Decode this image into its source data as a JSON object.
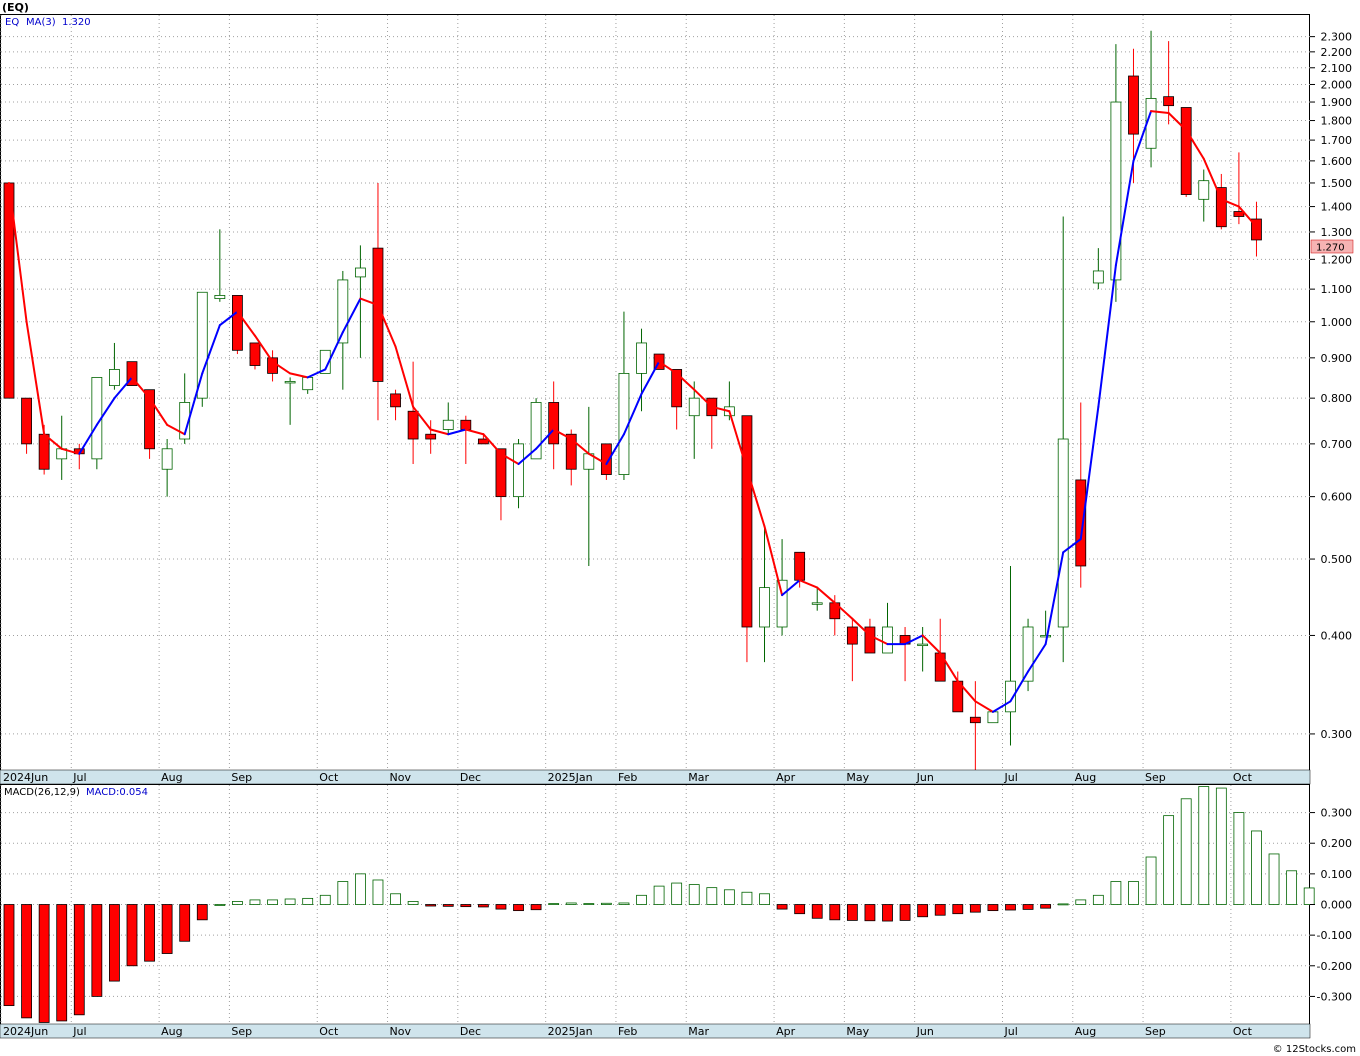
{
  "header": {
    "symbol": "(EQ)",
    "legend_symbol": "EQ",
    "legend_ma": "MA(3)",
    "legend_ma_value": "1.320",
    "last_price": "1.270",
    "macd_label": "MACD(26,12,9)",
    "macd_value": "MACD:0.054",
    "footer": "© 12Stocks.com"
  },
  "colors": {
    "up": "#006400",
    "down": "#ff0000",
    "ma_up": "#0000ff",
    "ma_down": "#ff0000",
    "grid": "#a0a0a0",
    "axis_band": "#cfe4ec",
    "price_tag": "#f6b3b3"
  },
  "chart_data": [
    {
      "type": "candlestick",
      "scale": "log",
      "ylim": [
        0.27,
        2.45
      ],
      "yticks": [
        "0.300",
        "0.400",
        "0.500",
        "0.600",
        "0.700",
        "0.800",
        "0.900",
        "1.000",
        "1.100",
        "1.200",
        "1.300",
        "1.400",
        "1.500",
        "1.600",
        "1.700",
        "1.800",
        "1.900",
        "2.000",
        "2.100",
        "2.200",
        "2.300"
      ],
      "month_labels": [
        {
          "label": "2024Jun",
          "week": 0
        },
        {
          "label": "Jul",
          "week": 4
        },
        {
          "label": "Aug",
          "week": 9
        },
        {
          "label": "Sep",
          "week": 13
        },
        {
          "label": "Oct",
          "week": 18
        },
        {
          "label": "Nov",
          "week": 22
        },
        {
          "label": "Dec",
          "week": 26
        },
        {
          "label": "2025Jan",
          "week": 31
        },
        {
          "label": "Feb",
          "week": 35
        },
        {
          "label": "Mar",
          "week": 39
        },
        {
          "label": "Apr",
          "week": 44
        },
        {
          "label": "May",
          "week": 48
        },
        {
          "label": "Jun",
          "week": 52
        },
        {
          "label": "Jul",
          "week": 57
        },
        {
          "label": "Aug",
          "week": 61
        },
        {
          "label": "Sep",
          "week": 65
        },
        {
          "label": "Oct",
          "week": 70
        }
      ],
      "ohlc": [
        [
          1.5,
          1.5,
          0.8,
          0.8
        ],
        [
          0.8,
          0.8,
          0.68,
          0.7
        ],
        [
          0.72,
          0.74,
          0.64,
          0.65
        ],
        [
          0.67,
          0.76,
          0.63,
          0.69
        ],
        [
          0.69,
          0.7,
          0.65,
          0.68
        ],
        [
          0.67,
          0.85,
          0.65,
          0.85
        ],
        [
          0.83,
          0.94,
          0.82,
          0.87
        ],
        [
          0.89,
          0.89,
          0.83,
          0.83
        ],
        [
          0.82,
          0.82,
          0.67,
          0.69
        ],
        [
          0.65,
          0.71,
          0.6,
          0.69
        ],
        [
          0.71,
          0.86,
          0.7,
          0.79
        ],
        [
          0.8,
          1.09,
          0.78,
          1.09
        ],
        [
          1.07,
          1.31,
          1.06,
          1.08
        ],
        [
          1.08,
          1.08,
          0.91,
          0.92
        ],
        [
          0.94,
          0.94,
          0.87,
          0.88
        ],
        [
          0.9,
          0.92,
          0.84,
          0.86
        ],
        [
          0.84,
          0.85,
          0.74,
          0.84
        ],
        [
          0.82,
          0.85,
          0.81,
          0.85
        ],
        [
          0.86,
          0.92,
          0.86,
          0.92
        ],
        [
          0.94,
          1.16,
          0.82,
          1.13
        ],
        [
          1.14,
          1.25,
          0.9,
          1.17
        ],
        [
          1.24,
          1.5,
          0.75,
          0.84
        ],
        [
          0.81,
          0.82,
          0.75,
          0.78
        ],
        [
          0.77,
          0.89,
          0.66,
          0.71
        ],
        [
          0.72,
          0.75,
          0.68,
          0.71
        ],
        [
          0.73,
          0.79,
          0.72,
          0.75
        ],
        [
          0.75,
          0.76,
          0.66,
          0.73
        ],
        [
          0.71,
          0.72,
          0.7,
          0.7
        ],
        [
          0.69,
          0.69,
          0.56,
          0.6
        ],
        [
          0.6,
          0.71,
          0.58,
          0.7
        ],
        [
          0.67,
          0.8,
          0.67,
          0.79
        ],
        [
          0.79,
          0.84,
          0.65,
          0.7
        ],
        [
          0.72,
          0.73,
          0.62,
          0.65
        ],
        [
          0.65,
          0.78,
          0.49,
          0.68
        ],
        [
          0.7,
          0.7,
          0.63,
          0.64
        ],
        [
          0.64,
          1.03,
          0.63,
          0.86
        ],
        [
          0.86,
          0.98,
          0.77,
          0.94
        ],
        [
          0.91,
          0.91,
          0.87,
          0.87
        ],
        [
          0.87,
          0.87,
          0.73,
          0.78
        ],
        [
          0.76,
          0.84,
          0.67,
          0.8
        ],
        [
          0.8,
          0.8,
          0.69,
          0.76
        ],
        [
          0.76,
          0.84,
          0.75,
          0.78
        ],
        [
          0.76,
          0.76,
          0.37,
          0.41
        ],
        [
          0.41,
          0.55,
          0.37,
          0.46
        ],
        [
          0.41,
          0.53,
          0.4,
          0.47
        ],
        [
          0.51,
          0.51,
          0.46,
          0.47
        ],
        [
          0.44,
          0.46,
          0.43,
          0.44
        ],
        [
          0.44,
          0.45,
          0.4,
          0.42
        ],
        [
          0.41,
          0.42,
          0.35,
          0.39
        ],
        [
          0.41,
          0.42,
          0.38,
          0.38
        ],
        [
          0.38,
          0.44,
          0.38,
          0.41
        ],
        [
          0.4,
          0.41,
          0.35,
          0.39
        ],
        [
          0.39,
          0.41,
          0.36,
          0.39
        ],
        [
          0.38,
          0.42,
          0.35,
          0.35
        ],
        [
          0.35,
          0.36,
          0.32,
          0.32
        ],
        [
          0.315,
          0.35,
          0.27,
          0.31
        ],
        [
          0.31,
          0.32,
          0.31,
          0.32
        ],
        [
          0.32,
          0.49,
          0.29,
          0.35
        ],
        [
          0.35,
          0.42,
          0.34,
          0.41
        ],
        [
          0.4,
          0.43,
          0.4,
          0.4
        ],
        [
          0.41,
          1.36,
          0.37,
          0.71
        ],
        [
          0.63,
          0.79,
          0.46,
          0.49
        ],
        [
          1.12,
          1.24,
          1.1,
          1.16
        ],
        [
          1.13,
          2.25,
          1.06,
          1.9
        ],
        [
          2.05,
          2.22,
          1.5,
          1.73
        ],
        [
          1.66,
          2.34,
          1.57,
          1.92
        ],
        [
          1.93,
          2.27,
          1.78,
          1.88
        ],
        [
          1.87,
          1.87,
          1.44,
          1.45
        ],
        [
          1.43,
          1.56,
          1.34,
          1.51
        ],
        [
          1.48,
          1.54,
          1.31,
          1.32
        ],
        [
          1.38,
          1.64,
          1.33,
          1.36
        ],
        [
          1.35,
          1.42,
          1.21,
          1.27
        ]
      ],
      "ma3": [
        1.5,
        1.0,
        0.72,
        0.69,
        0.68,
        0.74,
        0.8,
        0.85,
        0.8,
        0.74,
        0.72,
        0.86,
        0.99,
        1.03,
        0.96,
        0.89,
        0.86,
        0.85,
        0.87,
        0.97,
        1.07,
        1.05,
        0.93,
        0.78,
        0.73,
        0.72,
        0.73,
        0.72,
        0.68,
        0.66,
        0.69,
        0.73,
        0.71,
        0.68,
        0.66,
        0.72,
        0.81,
        0.89,
        0.86,
        0.82,
        0.78,
        0.77,
        0.65,
        0.55,
        0.45,
        0.47,
        0.46,
        0.44,
        0.42,
        0.4,
        0.39,
        0.39,
        0.4,
        0.38,
        0.35,
        0.33,
        0.32,
        0.33,
        0.36,
        0.39,
        0.51,
        0.53,
        0.78,
        1.18,
        1.6,
        1.85,
        1.84,
        1.75,
        1.61,
        1.43,
        1.4,
        1.32
      ]
    },
    {
      "type": "bar",
      "name": "MACD(26,12,9)",
      "ylim": [
        -0.39,
        0.39
      ],
      "yticks": [
        "0.300",
        "0.200",
        "0.100",
        "0.000",
        "-0.100",
        "-0.200",
        "-0.300"
      ],
      "values": [
        -0.33,
        -0.37,
        -0.385,
        -0.38,
        -0.36,
        -0.3,
        -0.25,
        -0.2,
        -0.185,
        -0.16,
        -0.12,
        -0.05,
        0.0,
        0.01,
        0.015,
        0.015,
        0.018,
        0.02,
        0.03,
        0.075,
        0.1,
        0.08,
        0.035,
        0.01,
        -0.005,
        -0.006,
        -0.007,
        -0.008,
        -0.015,
        -0.02,
        -0.017,
        0.003,
        0.005,
        0.003,
        0.004,
        0.005,
        0.03,
        0.06,
        0.07,
        0.065,
        0.055,
        0.048,
        0.04,
        0.035,
        -0.015,
        -0.03,
        -0.045,
        -0.05,
        -0.052,
        -0.053,
        -0.054,
        -0.052,
        -0.04,
        -0.035,
        -0.03,
        -0.025,
        -0.02,
        -0.018,
        -0.016,
        -0.012,
        0.002,
        0.015,
        0.03,
        0.075,
        0.075,
        0.155,
        0.29,
        0.345,
        0.385,
        0.38,
        0.3,
        0.24,
        0.165,
        0.11,
        0.054
      ]
    }
  ]
}
